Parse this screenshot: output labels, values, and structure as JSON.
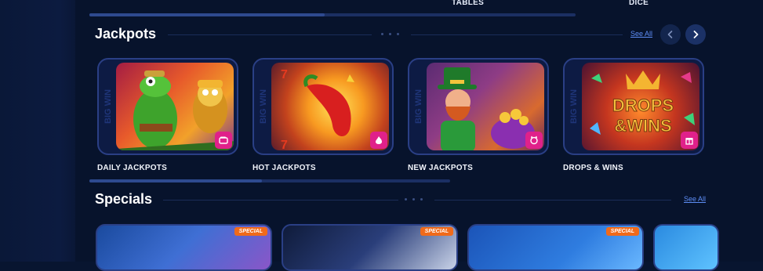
{
  "top_categories": [
    "TABLES",
    "DICE"
  ],
  "jackpots": {
    "title": "Jackpots",
    "see_all": "See All",
    "brand": "BIG WIN",
    "games": [
      {
        "label": "DAILY JACKPOTS",
        "icon": "wallet-icon"
      },
      {
        "label": "HOT JACKPOTS",
        "icon": "flame-icon"
      },
      {
        "label": "NEW JACKPOTS",
        "icon": "mascot-icon"
      },
      {
        "label": "DROPS & WINS",
        "icon": "gift-icon"
      }
    ],
    "drops_text": [
      "DROPS",
      "&WINS"
    ]
  },
  "specials": {
    "title": "Specials",
    "see_all": "See All",
    "badge": "SPECIAL",
    "cards": [
      {
        "badge": "SPECIAL"
      },
      {
        "badge": "SPECIAL"
      },
      {
        "badge": "SPECIAL"
      }
    ]
  },
  "colors": {
    "background": "#07132c",
    "accent": "#5d8df5",
    "badge_pink": "#e0218a",
    "special_orange": "#f06a1a"
  }
}
